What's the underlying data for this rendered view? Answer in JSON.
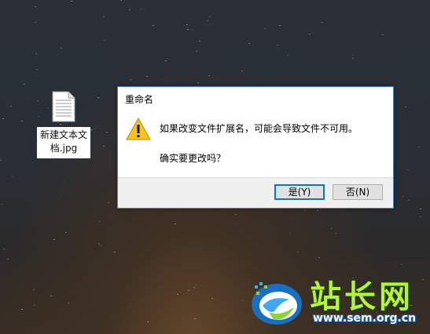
{
  "desktop": {
    "file_icon": {
      "icon": "document-icon",
      "label": "新建文本文档.jpg"
    }
  },
  "dialog": {
    "title": "重命名",
    "icon": "warning-icon",
    "message_line1": "如果改变文件扩展名，可能会导致文件不可用。",
    "message_line2": "确实要更改吗？",
    "buttons": {
      "yes_label": "是(Y)",
      "no_label": "否(N)"
    },
    "accent_color": "#0078d7"
  },
  "watermark": {
    "name": "站长网",
    "url": "www.sem.org.cn"
  }
}
